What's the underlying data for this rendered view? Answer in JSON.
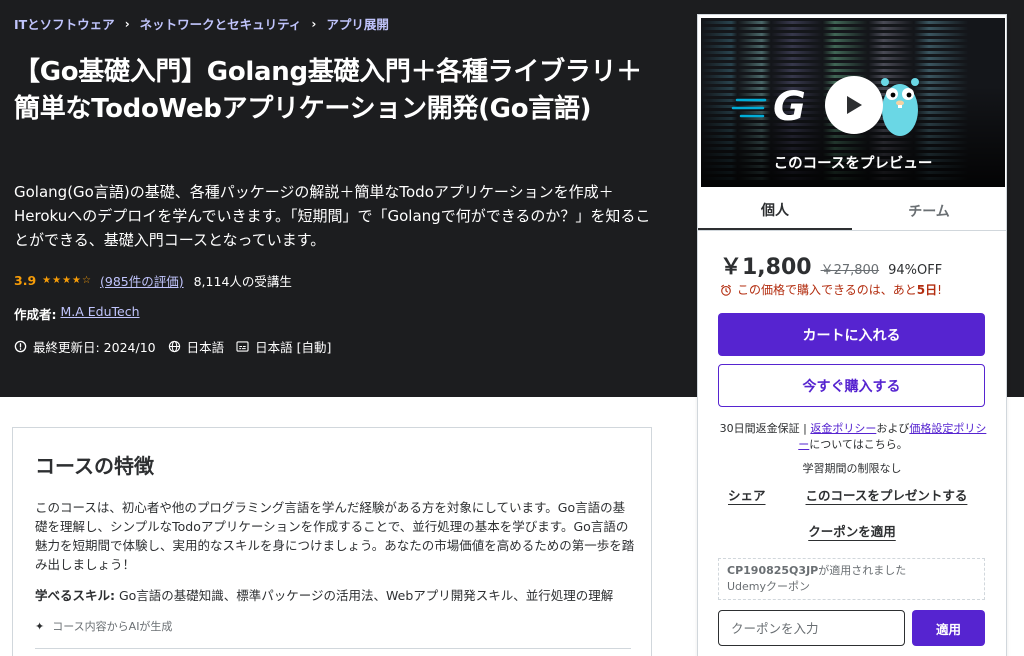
{
  "breadcrumb": [
    "ITとソフトウェア",
    "ネットワークとセキュリティ",
    "アプリ展開"
  ],
  "course": {
    "title": "【Go基礎入門】Golang基礎入門＋各種ライブラリ＋簡単なTodoWebアプリケーション開発(Go言語)",
    "subtitle": "Golang(Go言語)の基礎、各種パッケージの解説＋簡単なTodoアプリケーションを作成＋Herokuへのデプロイを学んでいきます。「短期間」で「Golangで何ができるのか？」を知ることができる、基礎入門コースとなっています。",
    "rating": "3.9",
    "stars": 3.9,
    "rating_count": "(985件の評価)",
    "students": "8,114人の受講生",
    "author_label": "作成者:",
    "author": "M.A EduTech",
    "last_updated": "最終更新日: 2024/10",
    "language": "日本語",
    "captions": "日本語 [自動]"
  },
  "card": {
    "preview_label": "このコースをプレビュー",
    "preview_logo": "G",
    "tabs": [
      "個人",
      "チーム"
    ],
    "price": "￥1,800",
    "original_price": "￥27,800",
    "discount": "94%OFF",
    "timer_text": "この価格で購入できるのは、あと",
    "timer_days": "5日",
    "timer_suffix": "!",
    "cart_button": "カートに入れる",
    "buy_button": "今すぐ購入する",
    "guarantee_prefix": "30日間返金保証 | ",
    "refund_policy": "返金ポリシー",
    "and": "および",
    "pricing_policy": "価格設定ポリシー",
    "guarantee_suffix": "についてはこちら。",
    "access": "学習期間の制限なし",
    "share": "シェア",
    "gift": "このコースをプレゼントする",
    "apply_coupon": "クーポンを適用",
    "applied_code": "CP190825Q3JP",
    "applied_text": "が適用されました",
    "applied_sub": "Udemyクーポン",
    "coupon_placeholder": "クーポンを入力",
    "apply_button": "適用"
  },
  "features": {
    "title": "コースの特徴",
    "body": "このコースは、初心者や他のプログラミング言語を学んだ経験がある方を対象にしています。Go言語の基礎を理解し、シンプルなTodoアプリケーションを作成することで、並行処理の基本を学びます。Go言語の魅力を短期間で体験し、実用的なスキルを身につけましょう。あなたの市場価値を高めるための第一歩を踏み出しましょう！",
    "skills_label": "学べるスキル:",
    "skills": " Go言語の基礎知識、標準パッケージの活用法、Webアプリ開発スキル、並行処理の理解",
    "ai_note": "コース内容からAIが生成"
  },
  "colors": {
    "accent": "#5624d0",
    "hero_bg": "#1c1d1f",
    "star": "#f69c08",
    "link_light": "#c0c4fc",
    "alert": "#b32d0f"
  }
}
